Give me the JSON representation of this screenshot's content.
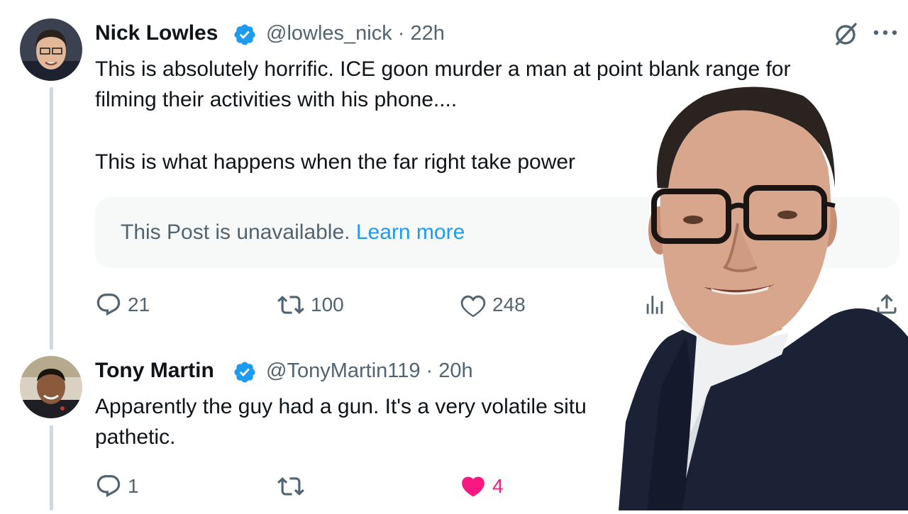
{
  "tweet1": {
    "author_name": "Nick Lowles",
    "handle_time": "@lowles_nick · 22h",
    "text_lines": [
      "This is absolutely horrific. ICE goon murder a man at point blank range for",
      "filming their activities with his phone....",
      "This is what happens when the far right take power"
    ],
    "quoted_post": {
      "message": "This Post is unavailable.",
      "link": "Learn more"
    },
    "actions": {
      "replies": "21",
      "reposts": "100",
      "likes": "248"
    }
  },
  "tweet2": {
    "author_name": "Tony Martin",
    "handle_time": "@TonyMartin119 · 20h",
    "text_lines": [
      "Apparently the guy had a gun. It's a very volatile situ",
      "pathetic."
    ],
    "actions": {
      "replies": "1",
      "reposts": "",
      "likes": "4"
    }
  },
  "icons": {
    "verified": "verified-badge-icon",
    "grok": "grok-icon",
    "more": "more-options-icon",
    "reply": "reply-icon",
    "repost": "repost-icon",
    "like": "like-icon",
    "views": "views-icon",
    "share": "share-icon"
  },
  "colors": {
    "verified_blue": "#1d9bf0",
    "muted_text": "#536471",
    "like_pink": "#f91880",
    "thread_line": "#cfd9de"
  }
}
